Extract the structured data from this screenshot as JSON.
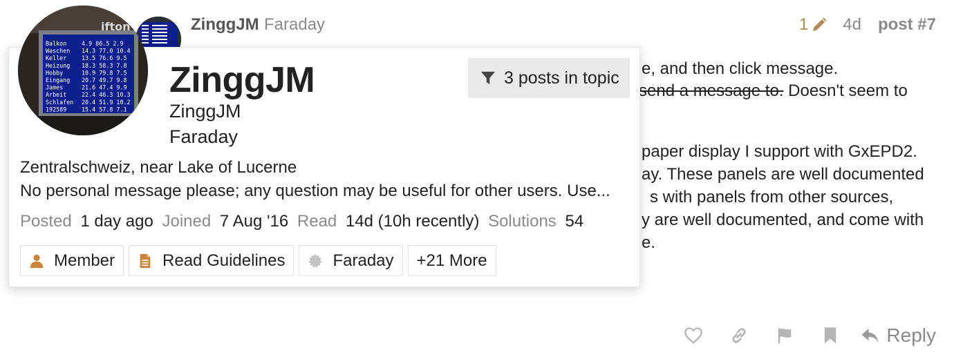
{
  "post": {
    "username": "ZinggJM",
    "user_title": "Faraday",
    "edits_count": "1",
    "age": "4d",
    "post_number": "post #7",
    "text_lines": [
      {
        "text": "e, and then click message."
      },
      {
        "struck": "send a message to.",
        "rest": " Doesn't seem to"
      },
      {
        "text": "paper display I support with GxEPD2."
      },
      {
        "text": "ay. These panels are well documented"
      },
      {
        "text": "s with panels from other sources,"
      },
      {
        "text": "y are well documented, and come with"
      },
      {
        "text": "e."
      }
    ],
    "reply_label": "Reply"
  },
  "user_card": {
    "name": "ZinggJM",
    "username": "ZinggJM",
    "title": "Faraday",
    "posts_in_topic_label": "3 posts in topic",
    "location": "Zentralschweiz, near Lake of Lucerne",
    "bio": "No personal message please; any question may be useful for other users. Use...",
    "stats": {
      "posted_label": "Posted",
      "posted_value": "1 day ago",
      "joined_label": "Joined",
      "joined_value": "7 Aug '16",
      "read_label": "Read",
      "read_value": "14d (10h recently)",
      "solutions_label": "Solutions",
      "solutions_value": "54"
    },
    "badges": [
      {
        "label": "Member",
        "icon": "user-icon",
        "color": "#c8853a"
      },
      {
        "label": "Read Guidelines",
        "icon": "document-icon",
        "color": "#c8853a"
      },
      {
        "label": "Faraday",
        "icon": "certificate-icon",
        "color": "#c4c4c4"
      }
    ],
    "more_badges_label": "+21 More",
    "avatar_display": {
      "rows": [
        {
          "name": "Balkon",
          "values": "4.9 86.5 2.9"
        },
        {
          "name": "Waschen",
          "values": "14.3 77.0 10.4"
        },
        {
          "name": "Keller",
          "values": "13.5 76.6 9.5"
        },
        {
          "name": "Heizung",
          "values": "18.3 58.3 7.8"
        },
        {
          "name": "Hobby",
          "values": "10.9 79.8 7.5"
        },
        {
          "name": "Eingang",
          "values": "20.7 49.7 9.8"
        },
        {
          "name": "James",
          "values": "21.6 47.4 9.9"
        },
        {
          "name": "Arbeit",
          "values": "22.4 46.3 10.3"
        },
        {
          "name": "Schlafen",
          "values": "20.4 51.9 10.2"
        },
        {
          "name": "192589",
          "values": "15.4 57.8 7.1"
        }
      ],
      "label_fragment": "ifton"
    }
  },
  "colors": {
    "accent_edit": "#b48a55",
    "muted_text": "#8a8a8a",
    "badge_bronze": "#c8853a",
    "screen_blue": "#0e1f8e"
  }
}
